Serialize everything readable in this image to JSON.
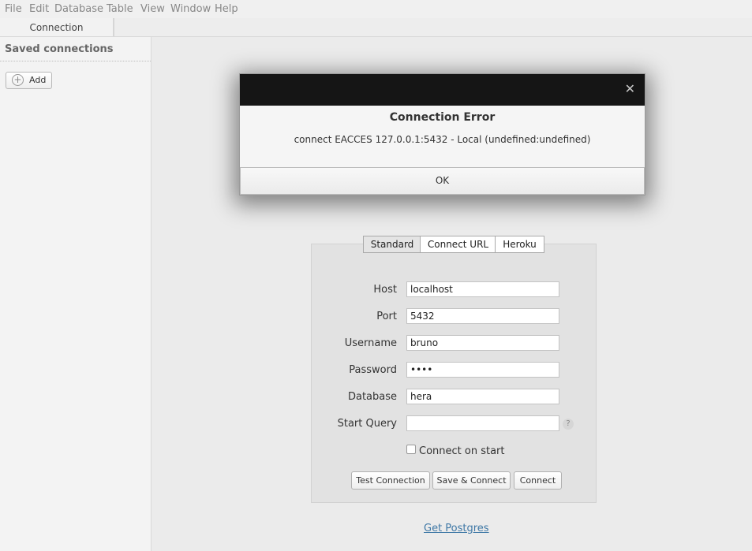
{
  "menu": [
    "File",
    "Edit",
    "Database",
    "Table",
    "View",
    "Window",
    "Help"
  ],
  "tabs": {
    "connection": "Connection"
  },
  "sidebar": {
    "title": "Saved connections",
    "add_label": "Add"
  },
  "dialog": {
    "title": "Connection Error",
    "message": "connect EACCES 127.0.0.1:5432 - Local (undefined:undefined)",
    "ok_label": "OK",
    "close_glyph": "✕"
  },
  "form": {
    "tabs": [
      "Standard",
      "Connect URL",
      "Heroku"
    ],
    "active_tab": "Standard",
    "fields": {
      "host": {
        "label": "Host",
        "value": "localhost"
      },
      "port": {
        "label": "Port",
        "value": "5432"
      },
      "username": {
        "label": "Username",
        "value": "bruno"
      },
      "password": {
        "label": "Password",
        "value": "••••"
      },
      "database": {
        "label": "Database",
        "value": "hera"
      },
      "start_query": {
        "label": "Start Query",
        "value": ""
      }
    },
    "help_glyph": "?",
    "connect_on_start": {
      "label": "Connect on start",
      "checked": false
    },
    "buttons": {
      "test": "Test Connection",
      "save_connect": "Save & Connect",
      "connect": "Connect"
    }
  },
  "footer": {
    "link": "Get Postgres"
  },
  "icons": {
    "add": "plus-circle-icon",
    "close": "close-icon",
    "help": "question-icon"
  },
  "colors": {
    "link": "#3f78a6",
    "dialog_header": "#151515"
  }
}
